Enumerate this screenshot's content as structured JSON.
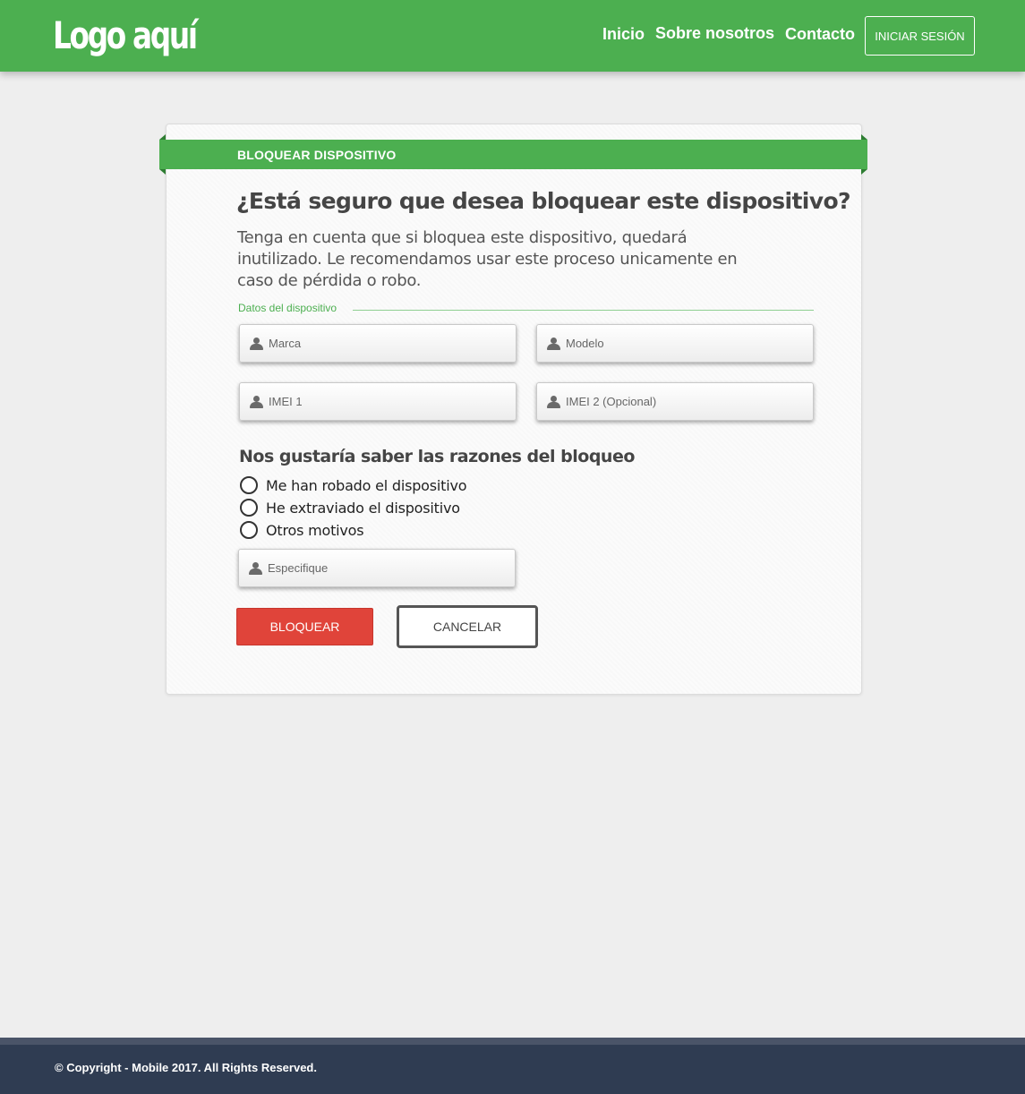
{
  "header": {
    "logo": "Logo aquí",
    "nav": [
      "Inicio",
      "Sobre nosotros",
      "Contacto"
    ],
    "login_label": "INICIAR SESIÓN",
    "color": "#4caf50"
  },
  "card": {
    "ribbon_title": "BLOQUEAR DISPOSITIVO",
    "question": "¿Está seguro que desea bloquear este dispositivo?",
    "description": "Tenga en cuenta que si bloquea este dispositivo, quedará inutilizado. Le recomendamos usar este proceso unicamente en caso de pérdida o robo.",
    "fieldset_legend": "Datos del dispositivo",
    "fields": {
      "marca": "Marca",
      "modelo": "Modelo",
      "imei1": "IMEI 1",
      "imei2": "IMEI 2 (Opcional)",
      "especifique": "Especifique"
    },
    "reasons_title": "Nos gustaría saber las razones del bloqueo",
    "reasons": [
      "Me han robado el dispositivo",
      "He extraviado el dispositivo",
      "Otros motivos"
    ],
    "block_label": "BLOQUEAR",
    "cancel_label": "CANCELAR",
    "block_color": "#e0443a"
  },
  "footer": {
    "copyright": "© Copyright - Mobile 2017. All Rights Reserved."
  },
  "icons": {
    "field_icon": "user-icon",
    "radio_icon": "radio-empty"
  }
}
